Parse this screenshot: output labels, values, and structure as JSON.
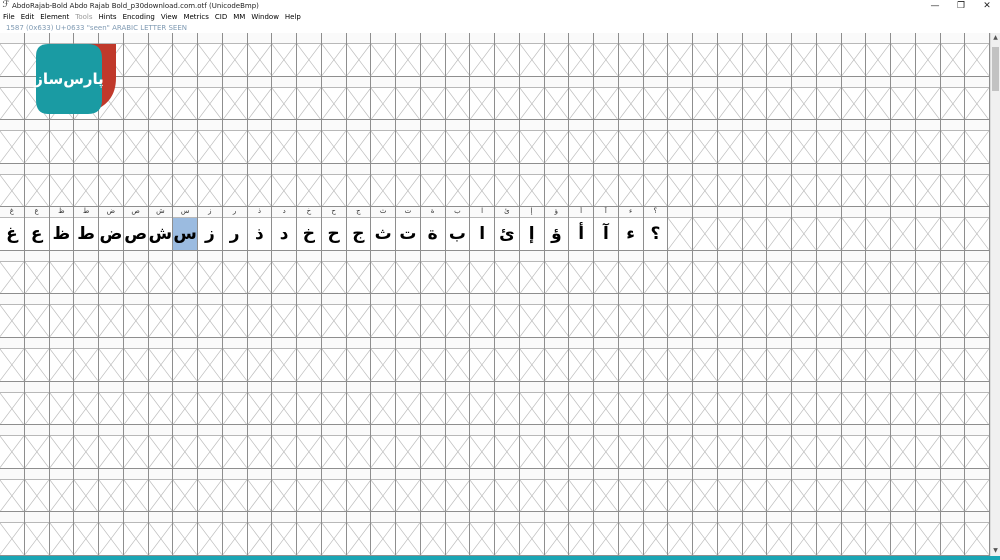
{
  "window": {
    "icon": "font-forge-icon",
    "title": "AbdoRajab-Bold  Abdo Rajab Bold_p30download.com.otf (UnicodeBmp)",
    "minimize_glyph": "—",
    "maximize_glyph": "❐",
    "close_glyph": "✕"
  },
  "menu": [
    {
      "label": "File",
      "enabled": true
    },
    {
      "label": "Edit",
      "enabled": true
    },
    {
      "label": "Element",
      "enabled": true
    },
    {
      "label": "Tools",
      "enabled": false
    },
    {
      "label": "Hints",
      "enabled": true
    },
    {
      "label": "Encoding",
      "enabled": true
    },
    {
      "label": "View",
      "enabled": true
    },
    {
      "label": "Metrics",
      "enabled": true
    },
    {
      "label": "CID",
      "enabled": true
    },
    {
      "label": "MM",
      "enabled": true
    },
    {
      "label": "Window",
      "enabled": true
    },
    {
      "label": "Help",
      "enabled": true
    }
  ],
  "info": {
    "text": "1587 (0x633) U+0633 \"seen\" ARABIC LETTER SEEN"
  },
  "logo": {
    "text": "پارس‌ساز",
    "colors": {
      "teal": "#1a9ba3",
      "red": "#c0392b",
      "white": "#ffffff"
    }
  },
  "colors": {
    "selection": "#9bbbe0",
    "grid_line": "#8e8e8e",
    "bottom_stripe": "#1aa6b5",
    "empty_cross": "#bdbdbd"
  },
  "grid": {
    "columns": 40,
    "rows": [
      {
        "labels": [
          "",
          "",
          "",
          "",
          "",
          "",
          "",
          "",
          "",
          "",
          "",
          "",
          "",
          "",
          "",
          "",
          "",
          "",
          "",
          "",
          "",
          "",
          "",
          "",
          "",
          "",
          "",
          "",
          "",
          "",
          "",
          "",
          "",
          "",
          "",
          "",
          "",
          "",
          "",
          ""
        ],
        "glyphs": [
          "",
          "",
          "",
          "",
          "",
          "",
          "",
          "",
          "",
          "",
          "",
          "",
          "",
          "",
          "",
          "",
          "",
          "",
          "",
          "",
          "",
          "",
          "",
          "",
          "",
          "",
          "",
          "",
          "",
          "",
          "",
          "",
          "",
          "",
          "",
          "",
          "",
          "",
          "",
          ""
        ]
      },
      {
        "labels": [
          "",
          "",
          "",
          "",
          "",
          "",
          "",
          "",
          "",
          "",
          "",
          "",
          "",
          "",
          "",
          "",
          "",
          "",
          "",
          "",
          "",
          "",
          "",
          "",
          "",
          "",
          "",
          "",
          "",
          "",
          "",
          "",
          "",
          "",
          "",
          "",
          "",
          "",
          "",
          ""
        ],
        "glyphs": [
          "",
          "",
          "",
          "",
          "",
          "",
          "",
          "",
          "",
          "",
          "",
          "",
          "",
          "",
          "",
          "",
          "",
          "",
          "",
          "",
          "",
          "",
          "",
          "",
          "",
          "",
          "",
          "",
          "",
          "",
          "",
          "",
          "",
          "",
          "",
          "",
          "",
          "",
          "",
          ""
        ]
      },
      {
        "labels": [
          "",
          "",
          "",
          "",
          "",
          "",
          "",
          "",
          "",
          "",
          "",
          "",
          "",
          "",
          "",
          "",
          "",
          "",
          "",
          "",
          "",
          "",
          "",
          "",
          "",
          "",
          "",
          "",
          "",
          "",
          "",
          "",
          "",
          "",
          "",
          "",
          "",
          "",
          "",
          ""
        ],
        "glyphs": [
          "",
          "",
          "",
          "",
          "",
          "",
          "",
          "",
          "",
          "",
          "",
          "",
          "",
          "",
          "",
          "",
          "",
          "",
          "",
          "",
          "",
          "",
          "",
          "",
          "",
          "",
          "",
          "",
          "",
          "",
          "",
          "",
          "",
          "",
          "",
          "",
          "",
          "",
          "",
          ""
        ]
      },
      {
        "labels": [
          "",
          "",
          "",
          "",
          "",
          "",
          "",
          "",
          "",
          "",
          "",
          "",
          "",
          "",
          "",
          "",
          "",
          "",
          "",
          "",
          "",
          "",
          "",
          "",
          "",
          "",
          "",
          "",
          "",
          "",
          "",
          "",
          "",
          "",
          "",
          "",
          "",
          "",
          "",
          ""
        ],
        "glyphs": [
          "",
          "",
          "",
          "",
          "",
          "",
          "",
          "",
          "",
          "",
          "",
          "",
          "",
          "",
          "",
          "",
          "",
          "",
          "",
          "",
          "",
          "",
          "",
          "",
          "",
          "",
          "",
          "",
          "",
          "",
          "",
          "",
          "",
          "",
          "",
          "",
          "",
          "",
          "",
          ""
        ]
      },
      {
        "labels": [
          "غ",
          "ع",
          "ظ",
          "ط",
          "ض",
          "ص",
          "ش",
          "س",
          "ز",
          "ر",
          "ذ",
          "د",
          "خ",
          "ح",
          "ج",
          "ث",
          "ت",
          "ة",
          "ب",
          "ا",
          "ئ",
          "إ",
          "ؤ",
          "أ",
          "آ",
          "ء",
          "؟",
          "",
          "",
          "",
          "",
          "",
          "",
          "",
          "",
          "",
          "",
          "",
          "",
          ""
        ],
        "glyphs": [
          "غ",
          "ع",
          "ظ",
          "ط",
          "ض",
          "ص",
          "ش",
          "س",
          "ز",
          "ر",
          "ذ",
          "د",
          "خ",
          "ح",
          "ج",
          "ث",
          "ت",
          "ة",
          "ب",
          "ا",
          "ئ",
          "إ",
          "ؤ",
          "أ",
          "آ",
          "ء",
          "؟",
          "",
          "",
          "",
          "",
          "",
          "",
          "",
          "",
          "",
          "",
          "",
          "",
          ""
        ]
      },
      {
        "labels": [
          "",
          "",
          "",
          "",
          "",
          "",
          "",
          "",
          "",
          "",
          "",
          "",
          "",
          "",
          "",
          "",
          "",
          "",
          "",
          "",
          "",
          "",
          "",
          "",
          "",
          "",
          "",
          "",
          "",
          "",
          "",
          "",
          "",
          "",
          "",
          "",
          "",
          "",
          "",
          ""
        ],
        "glyphs": [
          "",
          "",
          "",
          "",
          "",
          "",
          "",
          "",
          "",
          "",
          "",
          "",
          "",
          "",
          "",
          "",
          "",
          "",
          "",
          "",
          "",
          "",
          "",
          "",
          "",
          "",
          "",
          "",
          "",
          "",
          "",
          "",
          "",
          "",
          "",
          "",
          "",
          "",
          "",
          ""
        ]
      },
      {
        "labels": [
          "",
          "",
          "",
          "",
          "",
          "",
          "",
          "",
          "",
          "",
          "",
          "",
          "",
          "",
          "",
          "",
          "",
          "",
          "",
          "",
          "",
          "",
          "",
          "",
          "",
          "",
          "",
          "",
          "",
          "",
          "",
          "",
          "",
          "",
          "",
          "",
          "",
          "",
          "",
          ""
        ],
        "glyphs": [
          "",
          "",
          "",
          "",
          "",
          "",
          "",
          "",
          "",
          "",
          "",
          "",
          "",
          "",
          "",
          "",
          "",
          "",
          "",
          "",
          "",
          "",
          "",
          "",
          "",
          "",
          "",
          "",
          "",
          "",
          "",
          "",
          "",
          "",
          "",
          "",
          "",
          "",
          "",
          ""
        ]
      },
      {
        "labels": [
          "",
          "",
          "",
          "",
          "",
          "",
          "",
          "",
          "",
          "",
          "",
          "",
          "",
          "",
          "",
          "",
          "",
          "",
          "",
          "",
          "",
          "",
          "",
          "",
          "",
          "",
          "",
          "",
          "",
          "",
          "",
          "",
          "",
          "",
          "",
          "",
          "",
          "",
          "",
          ""
        ],
        "glyphs": [
          "",
          "",
          "",
          "",
          "",
          "",
          "",
          "",
          "",
          "",
          "",
          "",
          "",
          "",
          "",
          "",
          "",
          "",
          "",
          "",
          "",
          "",
          "",
          "",
          "",
          "",
          "",
          "",
          "",
          "",
          "",
          "",
          "",
          "",
          "",
          "",
          "",
          "",
          "",
          ""
        ]
      },
      {
        "labels": [
          "",
          "",
          "",
          "",
          "",
          "",
          "",
          "",
          "",
          "",
          "",
          "",
          "",
          "",
          "",
          "",
          "",
          "",
          "",
          "",
          "",
          "",
          "",
          "",
          "",
          "",
          "",
          "",
          "",
          "",
          "",
          "",
          "",
          "",
          "",
          "",
          "",
          "",
          "",
          ""
        ],
        "glyphs": [
          "",
          "",
          "",
          "",
          "",
          "",
          "",
          "",
          "",
          "",
          "",
          "",
          "",
          "",
          "",
          "",
          "",
          "",
          "",
          "",
          "",
          "",
          "",
          "",
          "",
          "",
          "",
          "",
          "",
          "",
          "",
          "",
          "",
          "",
          "",
          "",
          "",
          "",
          "",
          ""
        ]
      },
      {
        "labels": [
          "",
          "",
          "",
          "",
          "",
          "",
          "",
          "",
          "",
          "",
          "",
          "",
          "",
          "",
          "",
          "",
          "",
          "",
          "",
          "",
          "",
          "",
          "",
          "",
          "",
          "",
          "",
          "",
          "",
          "",
          "",
          "",
          "",
          "",
          "",
          "",
          "",
          "",
          "",
          ""
        ],
        "glyphs": [
          "",
          "",
          "",
          "",
          "",
          "",
          "",
          "",
          "",
          "",
          "",
          "",
          "",
          "",
          "",
          "",
          "",
          "",
          "",
          "",
          "",
          "",
          "",
          "",
          "",
          "",
          "",
          "",
          "",
          "",
          "",
          "",
          "",
          "",
          "",
          "",
          "",
          "",
          "",
          ""
        ]
      },
      {
        "labels": [
          "",
          "",
          "",
          "",
          "",
          "",
          "",
          "",
          "",
          "",
          "",
          "",
          "",
          "",
          "",
          "",
          "",
          "",
          "",
          "",
          "",
          "",
          "",
          "",
          "",
          "",
          "",
          "",
          "",
          "",
          "",
          "",
          "",
          "",
          "",
          "",
          "",
          "",
          "",
          ""
        ],
        "glyphs": [
          "",
          "",
          "",
          "",
          "",
          "",
          "",
          "",
          "",
          "",
          "",
          "",
          "",
          "",
          "",
          "",
          "",
          "",
          "",
          "",
          "",
          "",
          "",
          "",
          "",
          "",
          "",
          "",
          "",
          "",
          "",
          "",
          "",
          "",
          "",
          "",
          "",
          "",
          "",
          ""
        ]
      },
      {
        "labels": [
          "",
          "",
          "",
          "",
          "",
          "",
          "",
          "",
          "",
          "",
          "",
          "",
          "",
          "",
          "",
          "",
          "",
          "",
          "",
          "",
          "",
          "",
          "",
          "",
          "",
          "",
          "",
          "",
          "",
          "",
          "",
          "",
          "",
          "",
          "",
          "",
          "",
          "",
          "",
          ""
        ],
        "glyphs": [
          "",
          "",
          "",
          "",
          "",
          "",
          "",
          "",
          "",
          "",
          "",
          "",
          "",
          "",
          "",
          "",
          "",
          "",
          "",
          "",
          "",
          "",
          "",
          "",
          "",
          "",
          "",
          "",
          "",
          "",
          "",
          "",
          "",
          "",
          "",
          "",
          "",
          "",
          "",
          ""
        ]
      }
    ]
  }
}
